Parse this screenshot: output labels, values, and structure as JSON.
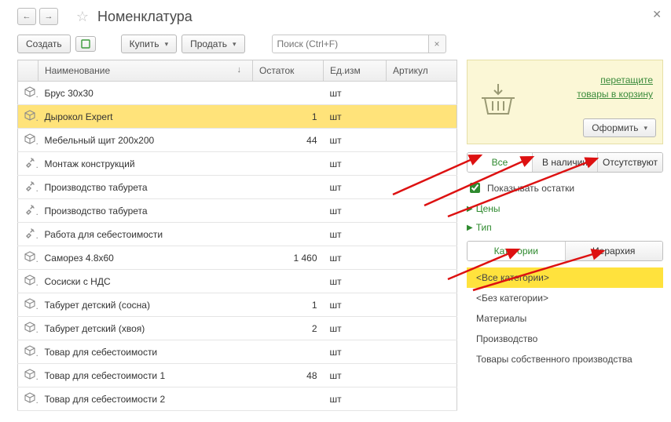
{
  "header": {
    "title": "Номенклатура"
  },
  "toolbar": {
    "create": "Создать",
    "buy": "Купить",
    "sell": "Продать",
    "search_placeholder": "Поиск (Ctrl+F)"
  },
  "grid": {
    "columns": {
      "name": "Наименование",
      "stock": "Остаток",
      "unit": "Ед.изм",
      "sku": "Артикул"
    },
    "rows": [
      {
        "icon": "cube",
        "name": "Брус 30х30",
        "stock": "",
        "unit": "шт",
        "selected": false
      },
      {
        "icon": "cube",
        "name": "Дырокол Expert",
        "stock": "1",
        "unit": "шт",
        "selected": true
      },
      {
        "icon": "cube",
        "name": "Мебельный щит 200х200",
        "stock": "44",
        "unit": "шт",
        "selected": false
      },
      {
        "icon": "tool",
        "name": "Монтаж конструкций",
        "stock": "",
        "unit": "шт",
        "selected": false
      },
      {
        "icon": "tool",
        "name": "Производство табурета",
        "stock": "",
        "unit": "шт",
        "selected": false
      },
      {
        "icon": "tool",
        "name": "Производство табурета",
        "stock": "",
        "unit": "шт",
        "selected": false
      },
      {
        "icon": "tool",
        "name": "Работа для себестоимости",
        "stock": "",
        "unit": "шт",
        "selected": false
      },
      {
        "icon": "cube",
        "name": "Саморез 4.8х60",
        "stock": "1 460",
        "unit": "шт",
        "selected": false
      },
      {
        "icon": "cube",
        "name": "Сосиски с НДС",
        "stock": "",
        "unit": "шт",
        "selected": false
      },
      {
        "icon": "cube",
        "name": "Табурет детский (сосна)",
        "stock": "1",
        "unit": "шт",
        "selected": false
      },
      {
        "icon": "cube",
        "name": "Табурет детский (хвоя)",
        "stock": "2",
        "unit": "шт",
        "selected": false
      },
      {
        "icon": "cube",
        "name": "Товар для себестоимости",
        "stock": "",
        "unit": "шт",
        "selected": false
      },
      {
        "icon": "cube",
        "name": "Товар для себестоимости 1",
        "stock": "48",
        "unit": "шт",
        "selected": false
      },
      {
        "icon": "cube",
        "name": "Товар для себестоимости 2",
        "stock": "",
        "unit": "шт",
        "selected": false
      }
    ]
  },
  "basket": {
    "hint_line1": "перетащите",
    "hint_line2": "товары в корзину",
    "confirm": "Оформить"
  },
  "stock_filter": {
    "all": "Все",
    "in_stock": "В наличии",
    "out": "Отсутствуют"
  },
  "show_stock_checkbox": "Показывать остатки",
  "expanders": {
    "prices": "Цены",
    "type": "Тип"
  },
  "view_tabs": {
    "categories": "Категории",
    "hierarchy": "Иерархия"
  },
  "categories": [
    {
      "label": "<Все категории>",
      "selected": true
    },
    {
      "label": "<Без категории>",
      "selected": false
    },
    {
      "label": "Материалы",
      "selected": false
    },
    {
      "label": "Производство",
      "selected": false
    },
    {
      "label": "Товары собственного производства",
      "selected": false
    }
  ]
}
